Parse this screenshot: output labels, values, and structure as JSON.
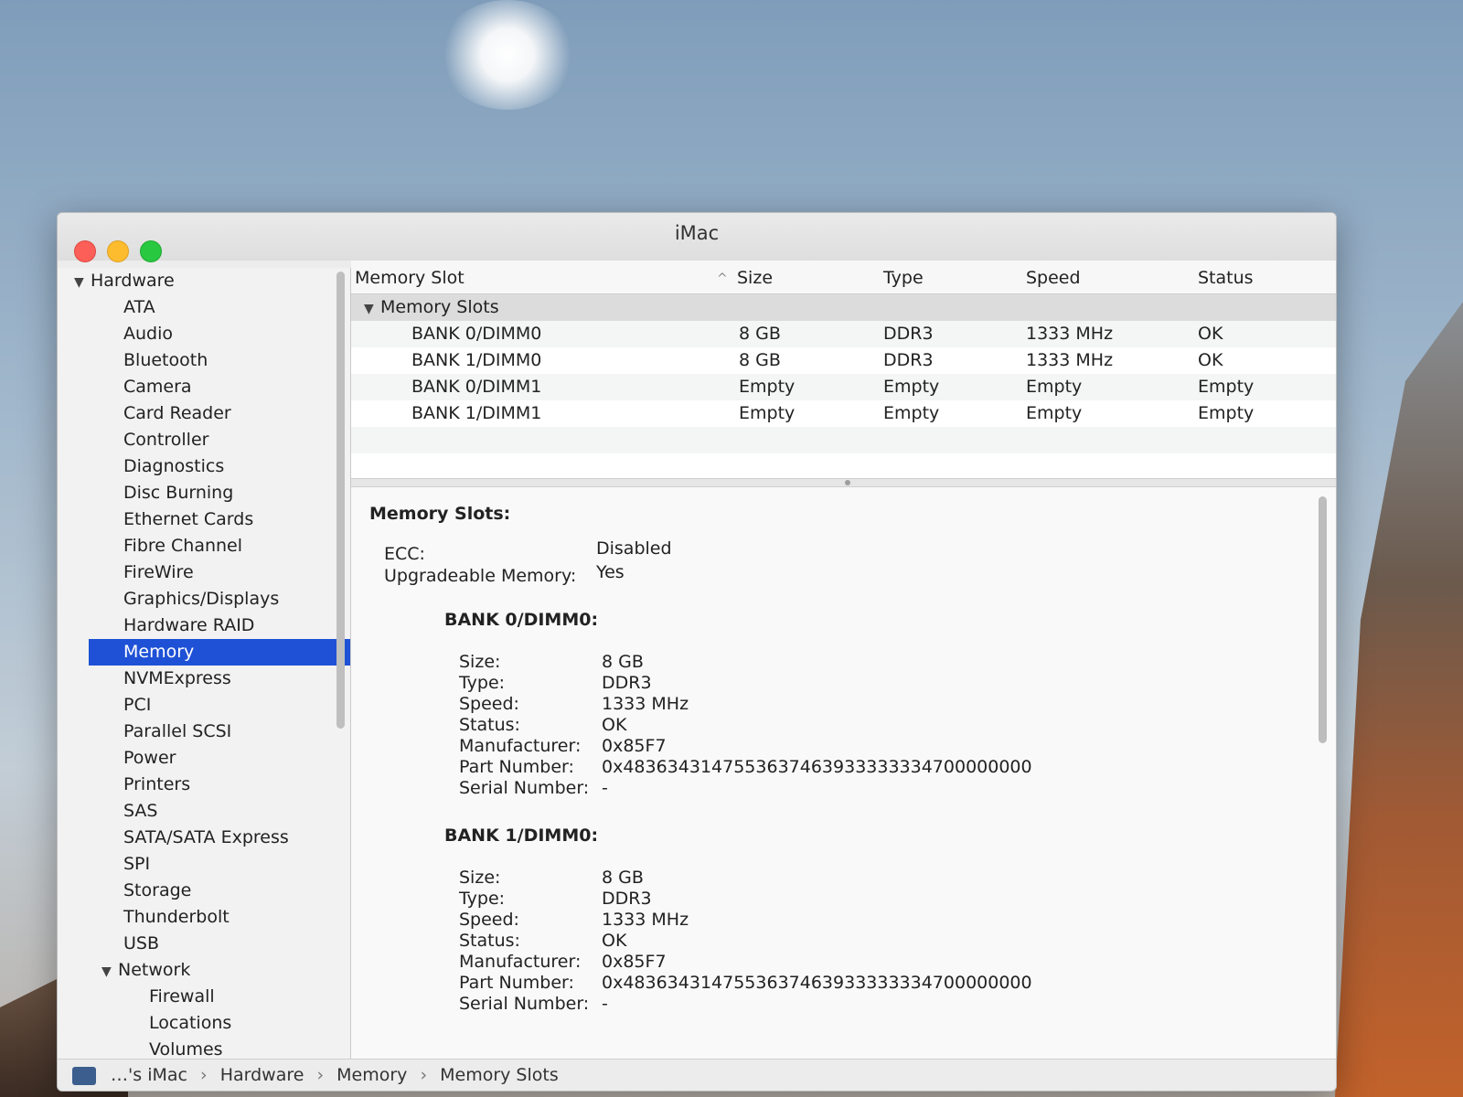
{
  "window": {
    "title": "iMac"
  },
  "sidebar": {
    "groups": [
      {
        "label": "Hardware",
        "items": [
          "ATA",
          "Audio",
          "Bluetooth",
          "Camera",
          "Card Reader",
          "Controller",
          "Diagnostics",
          "Disc Burning",
          "Ethernet Cards",
          "Fibre Channel",
          "FireWire",
          "Graphics/Displays",
          "Hardware RAID",
          "Memory",
          "NVMExpress",
          "PCI",
          "Parallel SCSI",
          "Power",
          "Printers",
          "SAS",
          "SATA/SATA Express",
          "SPI",
          "Storage",
          "Thunderbolt",
          "USB"
        ]
      },
      {
        "label": "Network",
        "items": [
          "Firewall",
          "Locations",
          "Volumes"
        ]
      }
    ],
    "selected": "Memory"
  },
  "table": {
    "columns": [
      "Memory Slot",
      "Size",
      "Type",
      "Speed",
      "Status"
    ],
    "sort_indicator": "^",
    "group_label": "Memory Slots",
    "rows": [
      {
        "slot": "BANK 0/DIMM0",
        "size": "8 GB",
        "type": "DDR3",
        "speed": "1333 MHz",
        "status": "OK"
      },
      {
        "slot": "BANK 1/DIMM0",
        "size": "8 GB",
        "type": "DDR3",
        "speed": "1333 MHz",
        "status": "OK"
      },
      {
        "slot": "BANK 0/DIMM1",
        "size": "Empty",
        "type": "Empty",
        "speed": "Empty",
        "status": "Empty"
      },
      {
        "slot": "BANK 1/DIMM1",
        "size": "Empty",
        "type": "Empty",
        "speed": "Empty",
        "status": "Empty"
      }
    ]
  },
  "detail": {
    "heading": "Memory Slots:",
    "ecc_label": "ECC:",
    "ecc_value": "Disabled",
    "upgradeable_label": "Upgradeable Memory:",
    "upgradeable_value": "Yes",
    "banks": [
      {
        "title": "BANK 0/DIMM0:",
        "size": "8 GB",
        "type": "DDR3",
        "speed": "1333 MHz",
        "status": "OK",
        "manufacturer": "0x85F7",
        "part_number": "0x4836343147553637463933333334700000000",
        "serial_number": "-"
      },
      {
        "title": "BANK 1/DIMM0:",
        "size": "8 GB",
        "type": "DDR3",
        "speed": "1333 MHz",
        "status": "OK",
        "manufacturer": "0x85F7",
        "part_number": "0x4836343147553637463933333334700000000",
        "serial_number": "-"
      }
    ],
    "labels": {
      "size": "Size:",
      "type": "Type:",
      "speed": "Speed:",
      "status": "Status:",
      "manufacturer": "Manufacturer:",
      "part_number": "Part Number:",
      "serial_number": "Serial Number:"
    }
  },
  "pathbar": {
    "items": [
      "…'s iMac",
      "Hardware",
      "Memory",
      "Memory Slots"
    ],
    "separator": "›"
  },
  "colors": {
    "selection": "#1e51d6",
    "close": "#fc5f57",
    "minimize": "#fdbc2e",
    "maximize": "#28c840"
  }
}
